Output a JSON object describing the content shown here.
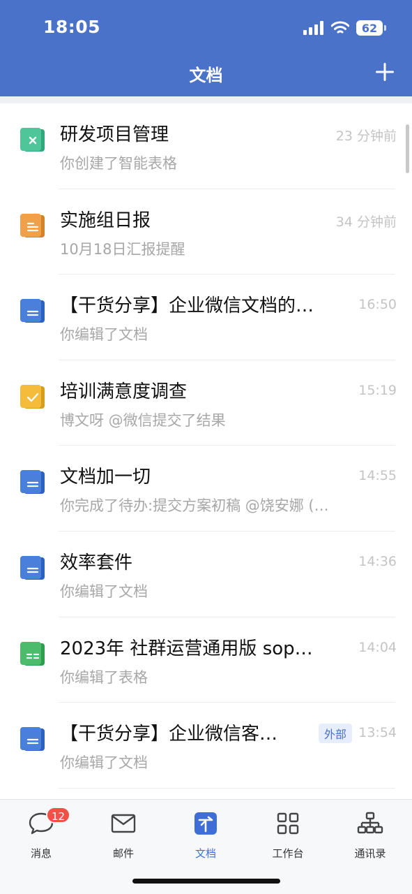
{
  "status_bar": {
    "time": "18:05",
    "battery": "62"
  },
  "header": {
    "title": "文档",
    "add_icon": "plus-icon"
  },
  "documents": [
    {
      "title": "研发项目管理",
      "subtitle": "你创建了智能表格",
      "time": "23 分钟前",
      "icon": "smart-sheet-icon",
      "color": "#4fc59a"
    },
    {
      "title": "实施组日报",
      "subtitle": "10月18日汇报提醒",
      "time": "34 分钟前",
      "icon": "report-icon",
      "color": "#f0a048"
    },
    {
      "title": "【干货分享】企业微信文档的…",
      "subtitle": "你编辑了文档",
      "time": "16:50",
      "icon": "doc-icon",
      "color": "#4a7fdc"
    },
    {
      "title": "培训满意度调查",
      "subtitle": "博文呀 @微信提交了结果",
      "time": "15:19",
      "icon": "form-icon",
      "color": "#f5bb3a"
    },
    {
      "title": "文档加一切",
      "subtitle": "你完成了待办:提交方案初稿 @饶安娜 (…",
      "time": "14:55",
      "icon": "doc-icon",
      "color": "#4a7fdc"
    },
    {
      "title": "效率套件",
      "subtitle": "你编辑了文档",
      "time": "14:36",
      "icon": "doc-icon",
      "color": "#4a7fdc"
    },
    {
      "title": "2023年 社群运营通用版 sop…",
      "subtitle": "你编辑了表格",
      "time": "14:04",
      "icon": "sheet-icon",
      "color": "#4cbb6b"
    },
    {
      "title": "【干货分享】企业微信客…",
      "subtitle": "你编辑了文档",
      "time": "13:54",
      "badge": "外部",
      "icon": "doc-icon",
      "color": "#4a7fdc"
    }
  ],
  "tabs": [
    {
      "label": "消息",
      "icon": "chat-bubble-icon",
      "unread": "12"
    },
    {
      "label": "邮件",
      "icon": "mail-icon"
    },
    {
      "label": "文档",
      "icon": "document-tab-icon",
      "active": true
    },
    {
      "label": "工作台",
      "icon": "grid-icon"
    },
    {
      "label": "通讯录",
      "icon": "org-chart-icon"
    }
  ],
  "colors": {
    "header": "#4a72c9",
    "active_tab": "#3f6fd6",
    "badge_red": "#f05146"
  }
}
